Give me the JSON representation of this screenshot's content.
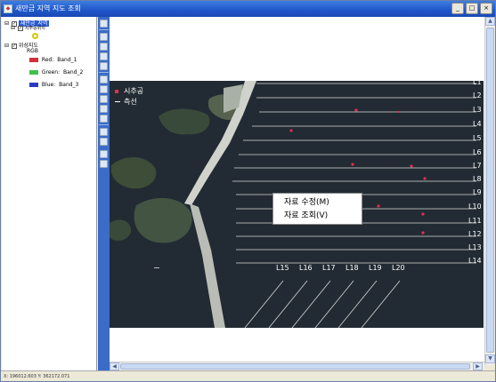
{
  "window": {
    "title": "새만금 지역 지도 조회",
    "controls": {
      "minimize": "_",
      "maximize": "□",
      "close": "×"
    }
  },
  "toc": {
    "layers": [
      {
        "label": "새만금_지역",
        "checked": true,
        "selected": true
      },
      {
        "label": "시추공위치",
        "checked": true
      },
      {
        "label": "위성지도",
        "checked": true,
        "sub_label": "RGB"
      }
    ],
    "bands": [
      {
        "channel": "Red:",
        "band": "Band_1",
        "color": "#d0313a"
      },
      {
        "channel": "Green:",
        "band": "Band_2",
        "color": "#3fbf4a"
      },
      {
        "channel": "Blue:",
        "band": "Band_3",
        "color": "#2a3bbf"
      }
    ]
  },
  "toolbar": {
    "tools": [
      "pan-icon",
      "zoom-in-icon",
      "zoom-out-icon",
      "full-extent-icon",
      "globe-icon",
      "select-icon",
      "identify-icon",
      "measure-icon",
      "add-data-icon",
      "print-icon",
      "layer-icon",
      "info-icon",
      "settings-icon",
      "edit-icon"
    ]
  },
  "map": {
    "legend": {
      "borehole": "시추공",
      "survey_line": "측선"
    },
    "horizontal_lines": [
      "L1",
      "L2",
      "L3",
      "L4",
      "L5",
      "L6",
      "L7",
      "L8",
      "L9",
      "L10",
      "L11",
      "L12",
      "L13",
      "L14"
    ],
    "diagonal_lines": [
      "L15",
      "L16",
      "L17",
      "L18",
      "L19",
      "L20"
    ],
    "colors": {
      "borehole": "#e03050",
      "sea": "#222b33",
      "line": "#d8d8d8"
    }
  },
  "context_menu": {
    "items": [
      "자료 수정(M)",
      "자료 조회(V)"
    ]
  },
  "statusbar": {
    "coordinates": "X: 196012.603  Y: 362172.071"
  }
}
